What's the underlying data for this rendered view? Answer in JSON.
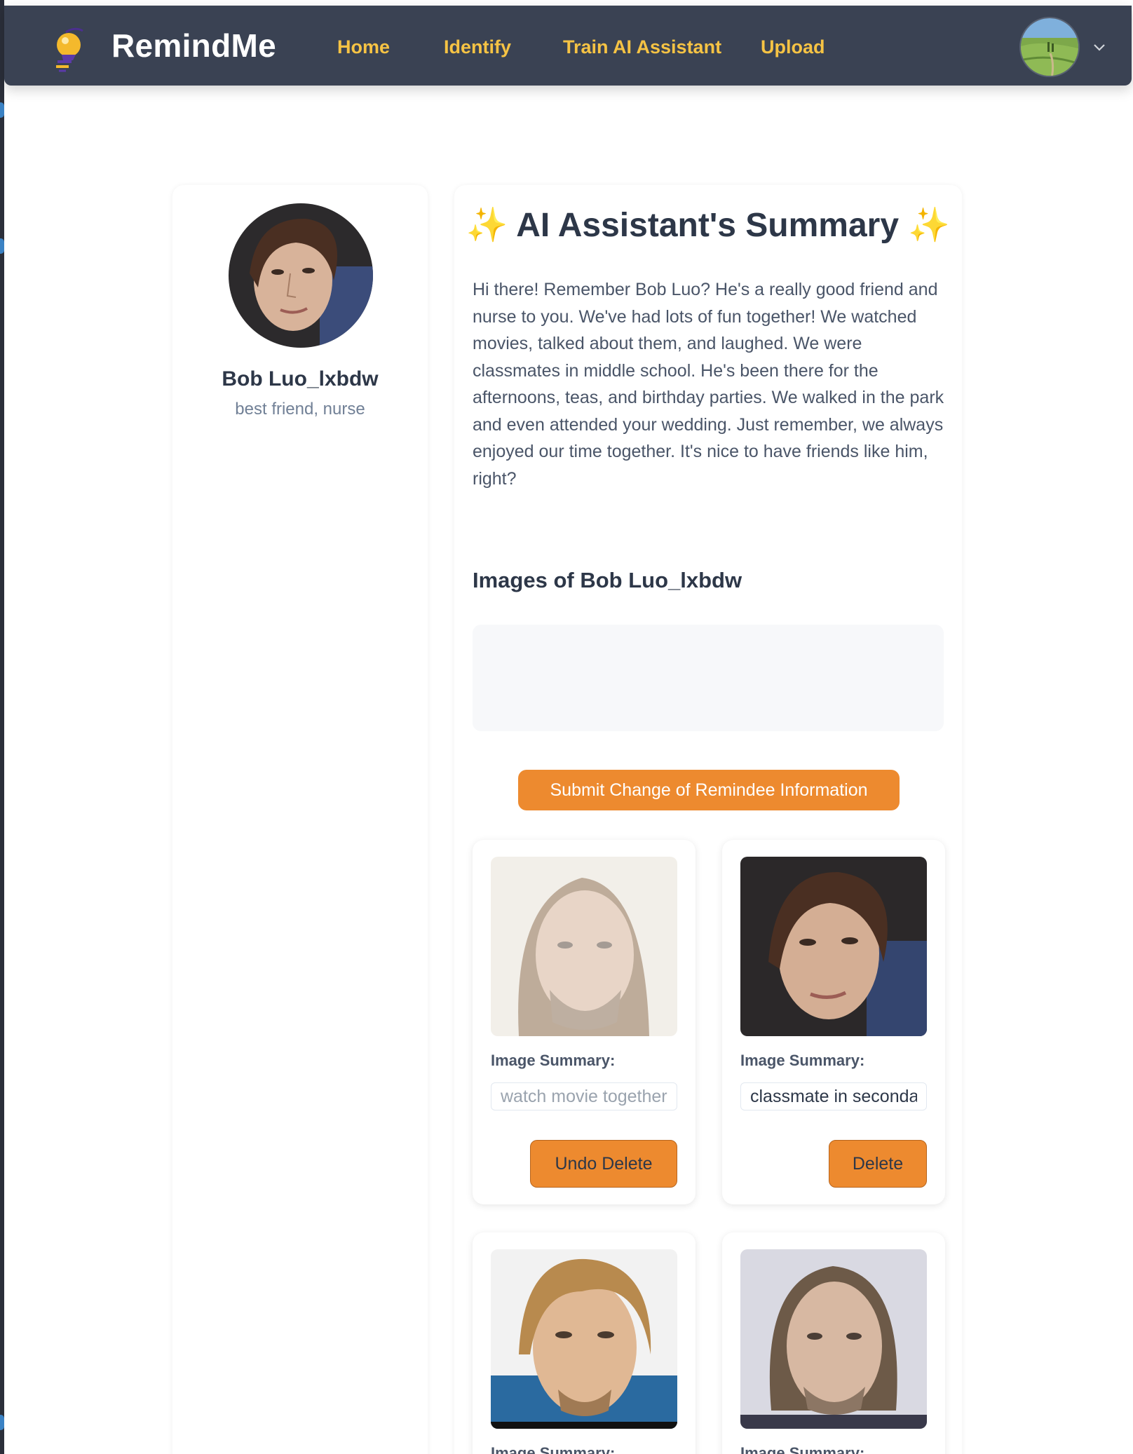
{
  "app": {
    "brand": "RemindMe"
  },
  "nav": {
    "links": [
      {
        "label": "Home"
      },
      {
        "label": "Identify"
      },
      {
        "label": "Train AI Assistant"
      },
      {
        "label": "Upload"
      }
    ],
    "icons": {
      "logo": "lightbulb-bee-logo",
      "chevron": "chevron-down-icon"
    }
  },
  "profile": {
    "name": "Bob Luo_lxbdw",
    "relation": "best friend, nurse"
  },
  "summary": {
    "title": "AI Assistant's Summary",
    "sparkle": "✨",
    "text": "Hi there! Remember Bob Luo? He's a really good friend and nurse to you. We've had lots of fun together! We watched movies, talked about them, and laughed. We were classmates in middle school. He's been there for the afternoons, teas, and birthday parties. We walked in the park and even attended your wedding. Just remember, we always enjoyed our time together. It's nice to have friends like him, right?"
  },
  "images_section": {
    "heading": "Images of Bob Luo_lxbdw",
    "submit_label": "Submit Change of Remindee Information"
  },
  "image_cards": [
    {
      "summary_label": "Image Summary:",
      "summary_value": "watch movie together",
      "button_label": "Undo Delete"
    },
    {
      "summary_label": "Image Summary:",
      "summary_value": "classmate in secondary school",
      "button_label": "Delete"
    },
    {
      "summary_label": "Image Summary:"
    },
    {
      "summary_label": "Image Summary:"
    }
  ],
  "colors": {
    "navbar": "#3a4253",
    "nav_link": "#f6c344",
    "accent_button": "#ed8a2f"
  }
}
